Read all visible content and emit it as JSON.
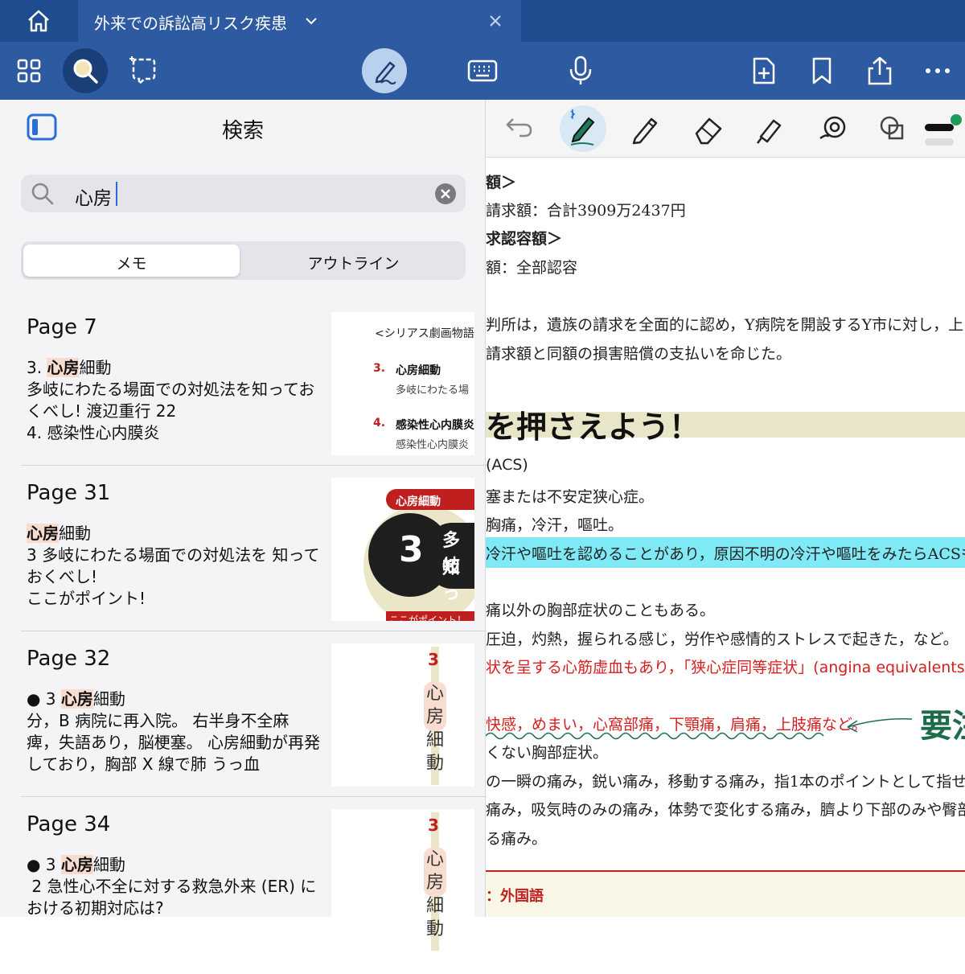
{
  "tab": {
    "title": "外来での訴訟高リスク疾患"
  },
  "sidebar": {
    "title": "検索",
    "search_value": "心房",
    "segments": [
      "メモ",
      "アウトライン"
    ]
  },
  "results": [
    {
      "page": "Page 7",
      "pre": "3. ",
      "hl": "心房",
      "post": "細動\n多岐にわたる場面での対処法を知っておくべし! 渡辺重行 22\n4. 感染性心内膜炎"
    },
    {
      "page": "Page 31",
      "pre": "",
      "hl": "心房",
      "post": "細動\n3 多岐にわたる場面での対処法を 知っておくべし!\nここがポイント!"
    },
    {
      "page": "Page 32",
      "pre": "● 3 ",
      "hl": "心房",
      "post": "細動\n分，B 病院に再入院。 右半身不全麻痺，失語あり，脳梗塞。 心房細動が再発しており，胸部 X 線で肺 うっ血"
    },
    {
      "page": "Page 34",
      "pre": "● 3 ",
      "hl": "心房",
      "post": "細動\n 2 急性心不全に対する救急外来 (ER) における初期対応は?"
    }
  ],
  "thumbs": {
    "p7": {
      "header": "<シリアス劇画物語",
      "n3": "3.",
      "t3": "心房細動",
      "s3": "多岐にわたる場",
      "n4": "4.",
      "t4": "感染性心内膜炎",
      "s4": "感染性心内膜炎"
    },
    "p31": {
      "tag": "心房細動",
      "num": "3",
      "line1": "多岐",
      "line2": "知っ",
      "foot": "ここがポイント！"
    },
    "p32": {
      "num": "3",
      "text": "心房細動"
    },
    "p34": {
      "num": "3",
      "text": "心房細動"
    }
  },
  "doc": {
    "l1": "額＞",
    "l2": "請求額：合計3909万2437円",
    "l3": "求認容額＞",
    "l4": "額：全部認容",
    "l5": "判所は，遺族の請求を全面的に認め，Y病院を開設するY市に対し，上",
    "l6": "請求額と同額の損害賠償の支払いを命じた。",
    "heading": "を押さえよう！",
    "l7": "(ACS)",
    "l8": "塞または不安定狭心症。",
    "l9": "胸痛，冷汗，嘔吐。",
    "l10": "冷汗や嘔吐を認めることがあり，原因不明の冷汗や嘔吐をみたらACSも",
    "l11": "痛以外の胸部症状のこともある。",
    "l12": "圧迫，灼熱，握られる感じ，労作や感情的ストレスで起きた，など。",
    "l13": "状を呈する心筋虚血もあり，「狭心症同等症状」(angina equivalents",
    "l14": "快感，めまい，心窩部痛，下顎痛，肩痛，上肢痛など。",
    "handwriting": "要注",
    "l15": "くない胸部症状。",
    "l16": "の一瞬の痛み，鋭い痛み，移動する痛み，指1本のポイントとして指せ",
    "l17": "痛み，吸気時のみの痛み，体勢で変化する痛み，臍より下部のみや臀部",
    "l18": "る痛み。",
    "l19": "：外国語"
  }
}
